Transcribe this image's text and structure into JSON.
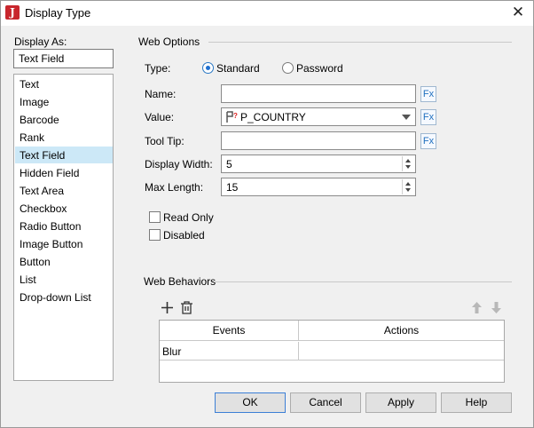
{
  "window": {
    "title": "Display Type"
  },
  "display_as": {
    "label": "Display As:",
    "value": "Text Field",
    "items": [
      "Text",
      "Image",
      "Barcode",
      "Rank",
      "Text Field",
      "Hidden Field",
      "Text Area",
      "Checkbox",
      "Radio Button",
      "Image Button",
      "Button",
      "List",
      "Drop-down List"
    ],
    "selected": "Text Field"
  },
  "web_options": {
    "header": "Web Options",
    "type_label": "Type:",
    "type_standard": "Standard",
    "type_password": "Password",
    "type_selected": "Standard",
    "name_label": "Name:",
    "name_value": "",
    "value_label": "Value:",
    "value_value": "P_COUNTRY",
    "tooltip_label": "Tool Tip:",
    "tooltip_value": "",
    "fx_label": "Fx",
    "display_width_label": "Display Width:",
    "display_width_value": "5",
    "max_length_label": "Max Length:",
    "max_length_value": "15",
    "read_only_label": "Read Only",
    "disabled_label": "Disabled"
  },
  "web_behaviors": {
    "header": "Web Behaviors",
    "columns": [
      "Events",
      "Actions"
    ],
    "rows": [
      {
        "event": "Blur",
        "action": ""
      }
    ]
  },
  "buttons": {
    "ok": "OK",
    "cancel": "Cancel",
    "apply": "Apply",
    "help": "Help"
  },
  "icons": {
    "app": "report-app-icon",
    "close": "close-icon",
    "add": "add-icon",
    "delete": "delete-icon",
    "move_up": "arrow-up-icon",
    "move_down": "arrow-down-icon",
    "parameter": "parameter-icon"
  },
  "colors": {
    "accent": "#1e6fd0",
    "selection": "#cce8f7",
    "app_icon": "#c8262d"
  }
}
